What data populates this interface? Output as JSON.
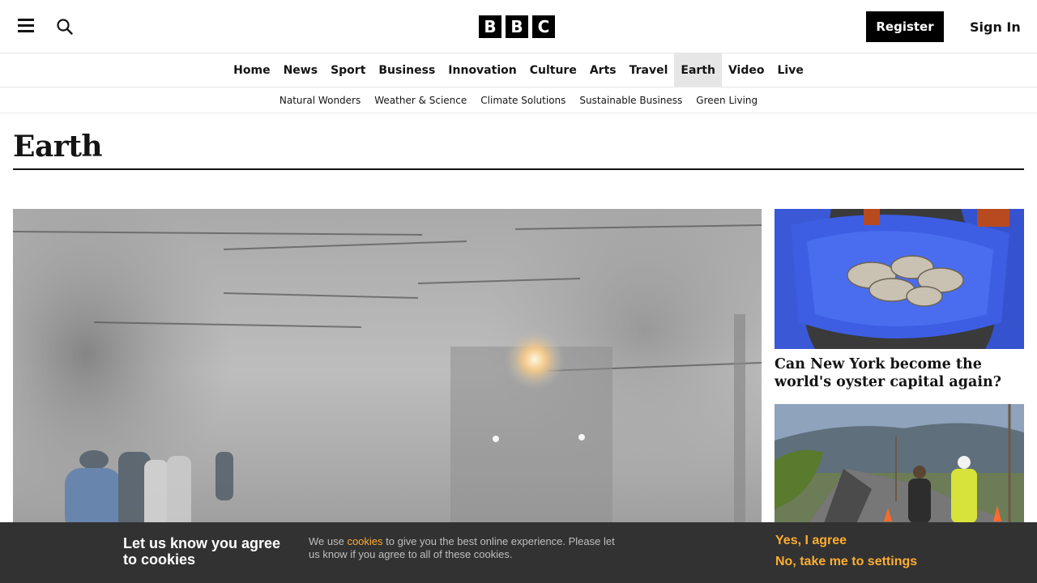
{
  "header": {
    "menu_icon": "hamburger-menu-icon",
    "search_icon": "search-icon",
    "logo_letters": [
      "B",
      "B",
      "C"
    ],
    "register_label": "Register",
    "signin_label": "Sign In"
  },
  "primary_nav": [
    {
      "label": "Home",
      "active": false
    },
    {
      "label": "News",
      "active": false
    },
    {
      "label": "Sport",
      "active": false
    },
    {
      "label": "Business",
      "active": false
    },
    {
      "label": "Innovation",
      "active": false
    },
    {
      "label": "Culture",
      "active": false
    },
    {
      "label": "Arts",
      "active": false
    },
    {
      "label": "Travel",
      "active": false
    },
    {
      "label": "Earth",
      "active": true
    },
    {
      "label": "Video",
      "active": false
    },
    {
      "label": "Live",
      "active": false
    }
  ],
  "secondary_nav": [
    "Natural Wonders",
    "Weather & Science",
    "Climate Solutions",
    "Sustainable Business",
    "Green Living"
  ],
  "section": {
    "title": "Earth"
  },
  "side_cards": [
    {
      "headline": "Can New York become the world's oyster capital again?"
    }
  ],
  "cookie_banner": {
    "heading": "Let us know you agree to cookies",
    "text_prefix": "We use ",
    "link_text": "cookies",
    "text_suffix": " to give you the best online experience. Please let us know if you agree to all of these cookies.",
    "accept_label": "Yes, I agree",
    "settings_label": "No, take me to settings"
  },
  "colors": {
    "accent": "#fdad31",
    "banner_bg": "#323232",
    "active_nav_bg": "#e6e6e6"
  }
}
